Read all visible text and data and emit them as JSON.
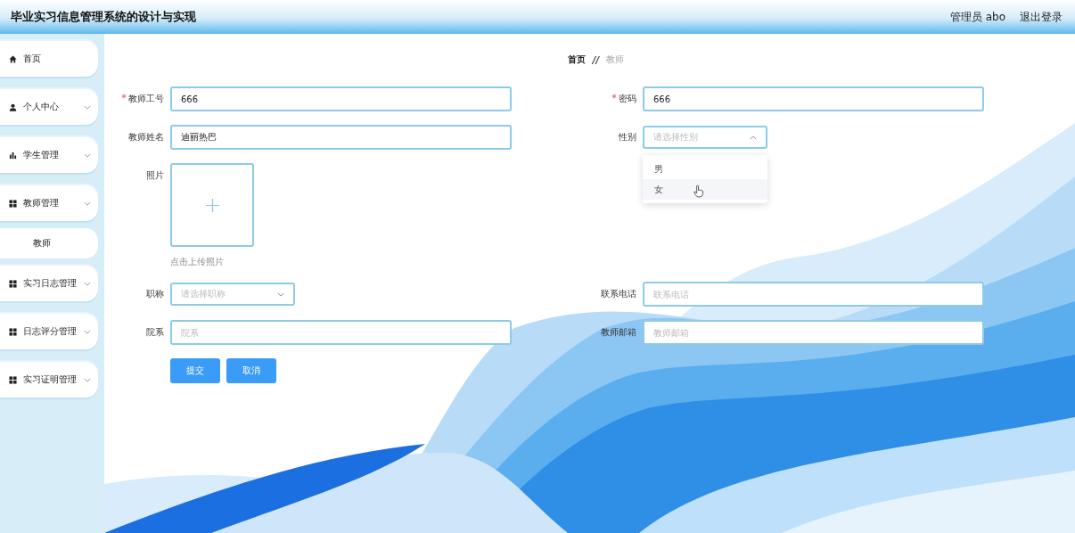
{
  "header": {
    "title": "毕业实习信息管理系统的设计与实现",
    "user": "管理员 abo",
    "logout": "退出登录"
  },
  "sidebar": {
    "items": [
      {
        "label": "首页",
        "kind": "home",
        "has_submenu": false
      },
      {
        "label": "个人中心",
        "kind": "user",
        "has_submenu": true
      },
      {
        "label": "学生管理",
        "kind": "chart",
        "has_submenu": true
      },
      {
        "label": "教师管理",
        "kind": "grid",
        "has_submenu": true,
        "children": [
          {
            "label": "教师"
          }
        ]
      },
      {
        "label": "实习日志管理",
        "kind": "grid",
        "has_submenu": true
      },
      {
        "label": "日志评分管理",
        "kind": "grid",
        "has_submenu": true
      },
      {
        "label": "实习证明管理",
        "kind": "grid",
        "has_submenu": true
      }
    ]
  },
  "breadcrumb": {
    "items": [
      "首页",
      "教师"
    ],
    "separator": "//"
  },
  "form": {
    "rows": [
      [
        {
          "label": "教师工号",
          "required": true,
          "kind": "input",
          "value": "666"
        },
        {
          "label": "密码",
          "required": true,
          "kind": "input",
          "value": "666"
        }
      ],
      [
        {
          "label": "教师姓名",
          "required": false,
          "kind": "input",
          "value": "迪丽热巴"
        },
        {
          "label": "性别",
          "required": false,
          "kind": "select",
          "placeholder": "请选择性别",
          "open": true,
          "options": [
            {
              "label": "男",
              "hovered": false
            },
            {
              "label": "女",
              "hovered": true
            }
          ]
        }
      ],
      [
        {
          "label": "照片",
          "required": false,
          "kind": "upload",
          "hint": "点击上传照片"
        }
      ],
      [
        {
          "label": "职称",
          "required": false,
          "kind": "select",
          "placeholder": "请选择职称",
          "open": false
        },
        {
          "label": "联系电话",
          "required": false,
          "kind": "input",
          "placeholder": "联系电话"
        }
      ],
      [
        {
          "label": "院系",
          "required": false,
          "kind": "input",
          "placeholder": "院系"
        },
        {
          "label": "教师邮箱",
          "required": false,
          "kind": "input",
          "placeholder": "教师邮箱"
        }
      ]
    ],
    "buttons": [
      "提交",
      "取消"
    ]
  }
}
